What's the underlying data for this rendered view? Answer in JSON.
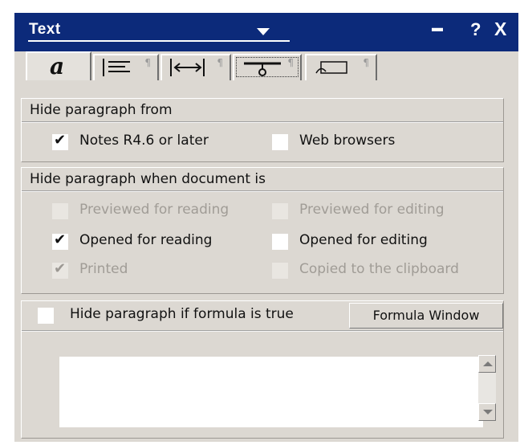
{
  "window": {
    "title": "Text",
    "dropdown_icon": "chevron-down-icon",
    "controls": [
      "minimize-icon",
      "help-icon",
      "close-icon"
    ],
    "help_glyph": "?",
    "close_glyph": "X",
    "dots_glyph": "▬"
  },
  "tabs": [
    {
      "name": "font",
      "glyph": "a",
      "active": true
    },
    {
      "name": "paragraph-alignment",
      "glyph": "≡"
    },
    {
      "name": "paragraph-margins",
      "glyph": "|↔|"
    },
    {
      "name": "paragraph-hide",
      "glyph": "⊥",
      "selected": true
    },
    {
      "name": "paragraph-styles",
      "glyph": "▭"
    }
  ],
  "hide_from": {
    "header": "Hide paragraph from",
    "notes": {
      "label": "Notes R4.6 or later",
      "checked": true
    },
    "web": {
      "label": "Web browsers",
      "checked": false
    }
  },
  "hide_when": {
    "header": "Hide paragraph when document is",
    "previewed_reading": {
      "label": "Previewed for reading",
      "checked": false,
      "disabled": true
    },
    "previewed_editing": {
      "label": "Previewed for editing",
      "checked": false,
      "disabled": true
    },
    "opened_reading": {
      "label": "Opened for reading",
      "checked": true,
      "disabled": false
    },
    "opened_editing": {
      "label": "Opened for editing",
      "checked": false,
      "disabled": false
    },
    "printed": {
      "label": "Printed",
      "checked": true,
      "disabled": true
    },
    "copied": {
      "label": "Copied to the clipboard",
      "checked": false,
      "disabled": true
    }
  },
  "formula": {
    "label": "Hide paragraph if formula is true",
    "checked": false,
    "button_label": "Formula Window",
    "value": ""
  },
  "check_glyph": "✔",
  "pilcrow": "¶"
}
